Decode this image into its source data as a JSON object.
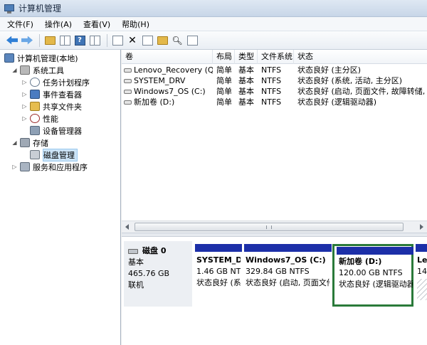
{
  "window": {
    "title": "计算机管理"
  },
  "menu": [
    "文件(F)",
    "操作(A)",
    "查看(V)",
    "帮助(H)"
  ],
  "toolbar": {
    "help_icon_label": "?"
  },
  "tree": {
    "root": "计算机管理(本地)",
    "system_tools": "系统工具",
    "task_scheduler": "任务计划程序",
    "event_viewer": "事件查看器",
    "shared_folders": "共享文件夹",
    "performance": "性能",
    "device_manager": "设备管理器",
    "storage": "存储",
    "disk_management": "磁盘管理",
    "services_apps": "服务和应用程序"
  },
  "volumes": {
    "columns": [
      "卷",
      "布局",
      "类型",
      "文件系统",
      "状态"
    ],
    "rows": [
      {
        "name": "Lenovo_Recovery (Q:)",
        "layout": "简单",
        "type": "基本",
        "fs": "NTFS",
        "status": "状态良好 (主分区)"
      },
      {
        "name": "SYSTEM_DRV",
        "layout": "简单",
        "type": "基本",
        "fs": "NTFS",
        "status": "状态良好 (系统, 活动, 主分区)"
      },
      {
        "name": "Windows7_OS (C:)",
        "layout": "简单",
        "type": "基本",
        "fs": "NTFS",
        "status": "状态良好 (启动, 页面文件, 故障转储, 主分"
      },
      {
        "name": "新加卷 (D:)",
        "layout": "简单",
        "type": "基本",
        "fs": "NTFS",
        "status": "状态良好 (逻辑驱动器)"
      }
    ]
  },
  "disk": {
    "name": "磁盘 0",
    "type": "基本",
    "size": "465.76 GB",
    "status": "联机",
    "partitions": [
      {
        "name": "SYSTEM_DI",
        "size": "1.46 GB NTFS",
        "status": "状态良好 (系"
      },
      {
        "name": "Windows7_OS  (C:)",
        "size": "329.84 GB NTFS",
        "status": "状态良好 (启动, 页面文件"
      },
      {
        "name": "新加卷  (D:)",
        "size": "120.00 GB NTFS",
        "status": "状态良好 (逻辑驱动器"
      },
      {
        "name": "Le",
        "size": "14",
        "status": ""
      }
    ]
  },
  "colors": {
    "partition_bar": "#1c2fa8",
    "selection_border": "#2a7a3a",
    "tree_selection": "#cce4f7"
  }
}
